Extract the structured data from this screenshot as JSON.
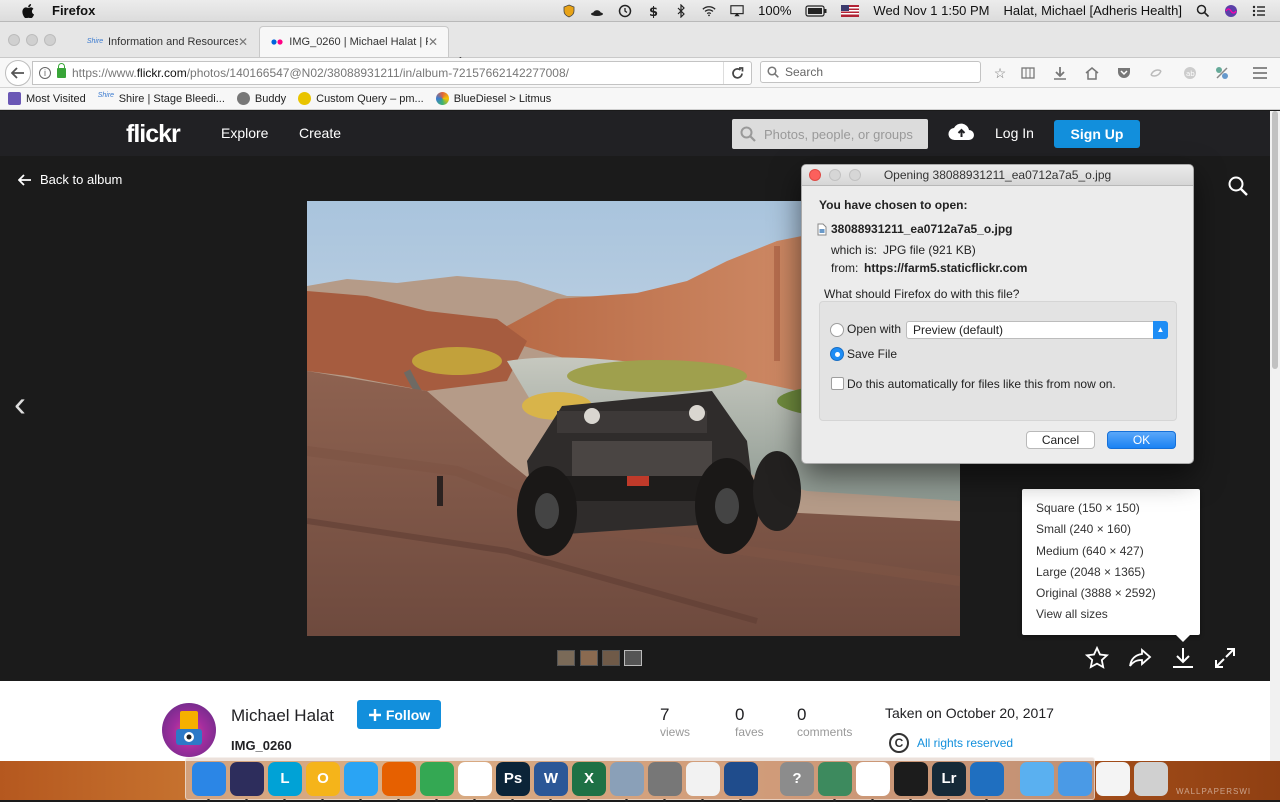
{
  "menubar": {
    "app_name": "Firefox",
    "battery": "100%",
    "datetime": "Wed Nov 1  1:50 PM",
    "user": "Halat, Michael [Adheris Health]"
  },
  "tabs": [
    {
      "label": "Information and Resources fo",
      "close": "✕",
      "favicon": "Shire"
    },
    {
      "label": "IMG_0260 | Michael Halat | Fl",
      "close": "✕"
    }
  ],
  "urlbar": {
    "url_prefix": "https://www.",
    "url_host": "flickr.com",
    "url_path": "/photos/140166547@N02/38088931211/in/album-72157662142277008/"
  },
  "searchbar": {
    "placeholder": "Search"
  },
  "bookmarks": [
    {
      "label": "Most Visited",
      "color": "#6a57b5"
    },
    {
      "label": "Shire | Stage Bleedi...",
      "color": "#3b7bd0"
    },
    {
      "label": "Buddy",
      "color": "#555555"
    },
    {
      "label": "Custom Query – pm...",
      "color": "#e9c400"
    },
    {
      "label": "BlueDiesel > Litmus",
      "color": "#e2643b"
    }
  ],
  "flickr": {
    "logo": "flickr",
    "nav_explore": "Explore",
    "nav_create": "Create",
    "search_placeholder": "Photos, people, or groups",
    "login": "Log In",
    "signup": "Sign Up",
    "back_to_album": "Back to album"
  },
  "dialog": {
    "title": "Opening 38088931211_ea0712a7a5_o.jpg",
    "chosen_heading": "You have chosen to open:",
    "filename": "38088931211_ea0712a7a5_o.jpg",
    "which_is_label": "which is:",
    "which_is_value": "JPG file (921 KB)",
    "from_label": "from:",
    "from_value": "https://farm5.staticflickr.com",
    "question": "What should Firefox do with this file?",
    "open_with_label": "Open with",
    "open_with_value": "Preview (default)",
    "save_file_label": "Save File",
    "auto_label": "Do this automatically for files like this from now on.",
    "cancel": "Cancel",
    "ok": "OK",
    "selected_option": "Save File"
  },
  "sizes_menu": {
    "items": [
      "Square (150 × 150)",
      "Small (240 × 160)",
      "Medium (640 × 427)",
      "Large (2048 × 1365)",
      "Original (3888 × 2592)",
      "View all sizes"
    ]
  },
  "photo_info": {
    "owner": "Michael Halat",
    "follow": "Follow",
    "title": "IMG_0260",
    "views_count": "7",
    "views_label": "views",
    "faves_count": "0",
    "faves_label": "faves",
    "comments_count": "0",
    "comments_label": "comments",
    "taken": "Taken on October 20, 2017",
    "rights_symbol": "C",
    "rights": "All rights reserved"
  },
  "dock_apps": [
    {
      "name": "Finder",
      "short": "",
      "color": "#2b86e6"
    },
    {
      "name": "Siri",
      "short": "",
      "color": "#2d2d5c"
    },
    {
      "name": "Lync",
      "short": "L",
      "color": "#00a2d6"
    },
    {
      "name": "Outlook",
      "short": "O",
      "color": "#f5b41a"
    },
    {
      "name": "Safari",
      "short": "",
      "color": "#2aa4f4"
    },
    {
      "name": "Firefox",
      "short": "",
      "color": "#e66000"
    },
    {
      "name": "Chrome",
      "short": "",
      "color": "#34a853"
    },
    {
      "name": "Acrobat",
      "short": "",
      "color": "#ffffff"
    },
    {
      "name": "Photoshop",
      "short": "Ps",
      "color": "#0b2438"
    },
    {
      "name": "Word",
      "short": "W",
      "color": "#2b5797"
    },
    {
      "name": "Excel",
      "short": "X",
      "color": "#1e7145"
    },
    {
      "name": "Preview",
      "short": "",
      "color": "#8aa0b8"
    },
    {
      "name": "System Preferences",
      "short": "",
      "color": "#777777"
    },
    {
      "name": "Photos",
      "short": "",
      "color": "#f2f2f2"
    },
    {
      "name": "SourceTree",
      "short": "",
      "color": "#1f4c8c"
    },
    {
      "name": "Help",
      "short": "?",
      "color": "#8c8c8c"
    },
    {
      "name": "Network",
      "short": "",
      "color": "#3d8a5e"
    },
    {
      "name": "Activity",
      "short": "",
      "color": "#ffffff"
    },
    {
      "name": "Terminal",
      "short": "",
      "color": "#1c1c1c"
    },
    {
      "name": "Lightroom",
      "short": "Lr",
      "color": "#162a38"
    },
    {
      "name": "VS Code",
      "short": "",
      "color": "#1f6fc0"
    },
    {
      "name": "Folder",
      "short": "",
      "color": "#5ab0f0"
    },
    {
      "name": "Applications",
      "short": "",
      "color": "#4a9ae6"
    },
    {
      "name": "Document",
      "short": "",
      "color": "#f4f4f4"
    },
    {
      "name": "Trash",
      "short": "",
      "color": "#d0d0d0"
    }
  ],
  "watermark": "WALLPAPERSWI",
  "colors": {
    "flickr_blue": "#128fdc",
    "flickr_dark": "#212124",
    "mac_blue": "#1e8df5"
  }
}
